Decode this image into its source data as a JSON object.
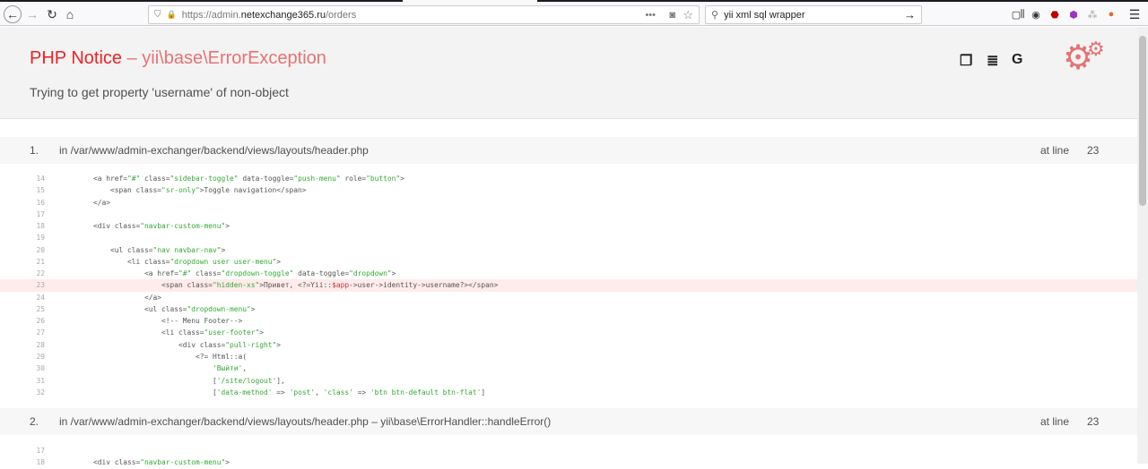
{
  "browser": {
    "url_prefix": "https://admin.",
    "url_domain": "netexchange365.ru",
    "url_path": "/orders",
    "search_value": "yii xml sql wrapper"
  },
  "error": {
    "type": "PHP Notice",
    "class": "– yii\\base\\ErrorException",
    "message": "Trying to get property 'username' of non-object"
  },
  "frames": [
    {
      "number": "1.",
      "path": "in /var/www/admin-exchanger/backend/views/layouts/header.php",
      "at_line_label": "at line",
      "line": "23",
      "highlight": "23",
      "lines": [
        {
          "n": "14",
          "c": [
            [
              "        <a href=",
              ""
            ],
            [
              "\"#\"",
              "s"
            ],
            [
              " class=",
              ""
            ],
            [
              "\"sidebar-toggle\"",
              "s"
            ],
            [
              " data-toggle=",
              ""
            ],
            [
              "\"push-menu\"",
              "s"
            ],
            [
              " role=",
              ""
            ],
            [
              "\"button\"",
              "s"
            ],
            [
              ">",
              ""
            ]
          ]
        },
        {
          "n": "15",
          "c": [
            [
              "            <span class=",
              ""
            ],
            [
              "\"sr-only\"",
              "s"
            ],
            [
              ">Toggle navigation</span>",
              ""
            ]
          ]
        },
        {
          "n": "16",
          "c": [
            [
              "        </a>",
              ""
            ]
          ]
        },
        {
          "n": "17",
          "c": []
        },
        {
          "n": "18",
          "c": [
            [
              "        <div class=",
              ""
            ],
            [
              "\"navbar-custom-menu\"",
              "s"
            ],
            [
              ">",
              ""
            ]
          ]
        },
        {
          "n": "19",
          "c": []
        },
        {
          "n": "20",
          "c": [
            [
              "            <ul class=",
              ""
            ],
            [
              "\"nav navbar-nav\"",
              "s"
            ],
            [
              ">",
              ""
            ]
          ]
        },
        {
          "n": "21",
          "c": [
            [
              "                <li class=",
              ""
            ],
            [
              "\"dropdown user user-menu\"",
              "s"
            ],
            [
              ">",
              ""
            ]
          ]
        },
        {
          "n": "22",
          "c": [
            [
              "                    <a href=",
              ""
            ],
            [
              "\"#\"",
              "s"
            ],
            [
              " class=",
              ""
            ],
            [
              "\"dropdown-toggle\"",
              "s"
            ],
            [
              " data-toggle=",
              ""
            ],
            [
              "\"dropdown\"",
              "s"
            ],
            [
              ">",
              ""
            ]
          ]
        },
        {
          "n": "23",
          "c": [
            [
              "                        <span class=",
              ""
            ],
            [
              "\"hidden-xs\"",
              "s"
            ],
            [
              ">Привет, <?=Yii::",
              ""
            ],
            [
              "$app",
              "v"
            ],
            [
              "->user->identity->username?></span>",
              ""
            ]
          ]
        },
        {
          "n": "24",
          "c": [
            [
              "                    </a>",
              ""
            ]
          ]
        },
        {
          "n": "25",
          "c": [
            [
              "                    <ul class=",
              ""
            ],
            [
              "\"dropdown-menu\"",
              "s"
            ],
            [
              ">",
              ""
            ]
          ]
        },
        {
          "n": "26",
          "c": [
            [
              "                        <!-- Menu Footer-->",
              ""
            ]
          ]
        },
        {
          "n": "27",
          "c": [
            [
              "                        <li class=",
              ""
            ],
            [
              "\"user-footer\"",
              "s"
            ],
            [
              ">",
              ""
            ]
          ]
        },
        {
          "n": "28",
          "c": [
            [
              "                            <div class=",
              ""
            ],
            [
              "\"pull-right\"",
              "s"
            ],
            [
              ">",
              ""
            ]
          ]
        },
        {
          "n": "29",
          "c": [
            [
              "                                <?= Html::a(",
              ""
            ]
          ]
        },
        {
          "n": "30",
          "c": [
            [
              "                                    ",
              ""
            ],
            [
              "'Выйти'",
              "s"
            ],
            [
              ",",
              ""
            ]
          ]
        },
        {
          "n": "31",
          "c": [
            [
              "                                    [",
              ""
            ],
            [
              "'/site/logout'",
              "s"
            ],
            [
              "],",
              ""
            ]
          ]
        },
        {
          "n": "32",
          "c": [
            [
              "                                    [",
              ""
            ],
            [
              "'data-method'",
              "s"
            ],
            [
              " => ",
              ""
            ],
            [
              "'post'",
              "s"
            ],
            [
              ", ",
              ""
            ],
            [
              "'class'",
              "s"
            ],
            [
              " => ",
              ""
            ],
            [
              "'btn btn-default btn-flat'",
              "s"
            ],
            [
              "]",
              ""
            ]
          ]
        }
      ]
    },
    {
      "number": "2.",
      "path": "in /var/www/admin-exchanger/backend/views/layouts/header.php – yii\\base\\ErrorHandler::handleError()",
      "at_line_label": "at line",
      "line": "23",
      "highlight": "",
      "lines": [
        {
          "n": "17",
          "c": []
        },
        {
          "n": "18",
          "c": [
            [
              "        <div class=",
              ""
            ],
            [
              "\"navbar-custom-menu\"",
              "s"
            ],
            [
              ">",
              ""
            ]
          ]
        }
      ]
    }
  ],
  "colors": {
    "error_red": "#ee2222",
    "error_sub": "#e57373",
    "string": "#33aa33",
    "highlight": "#ffebeb"
  }
}
